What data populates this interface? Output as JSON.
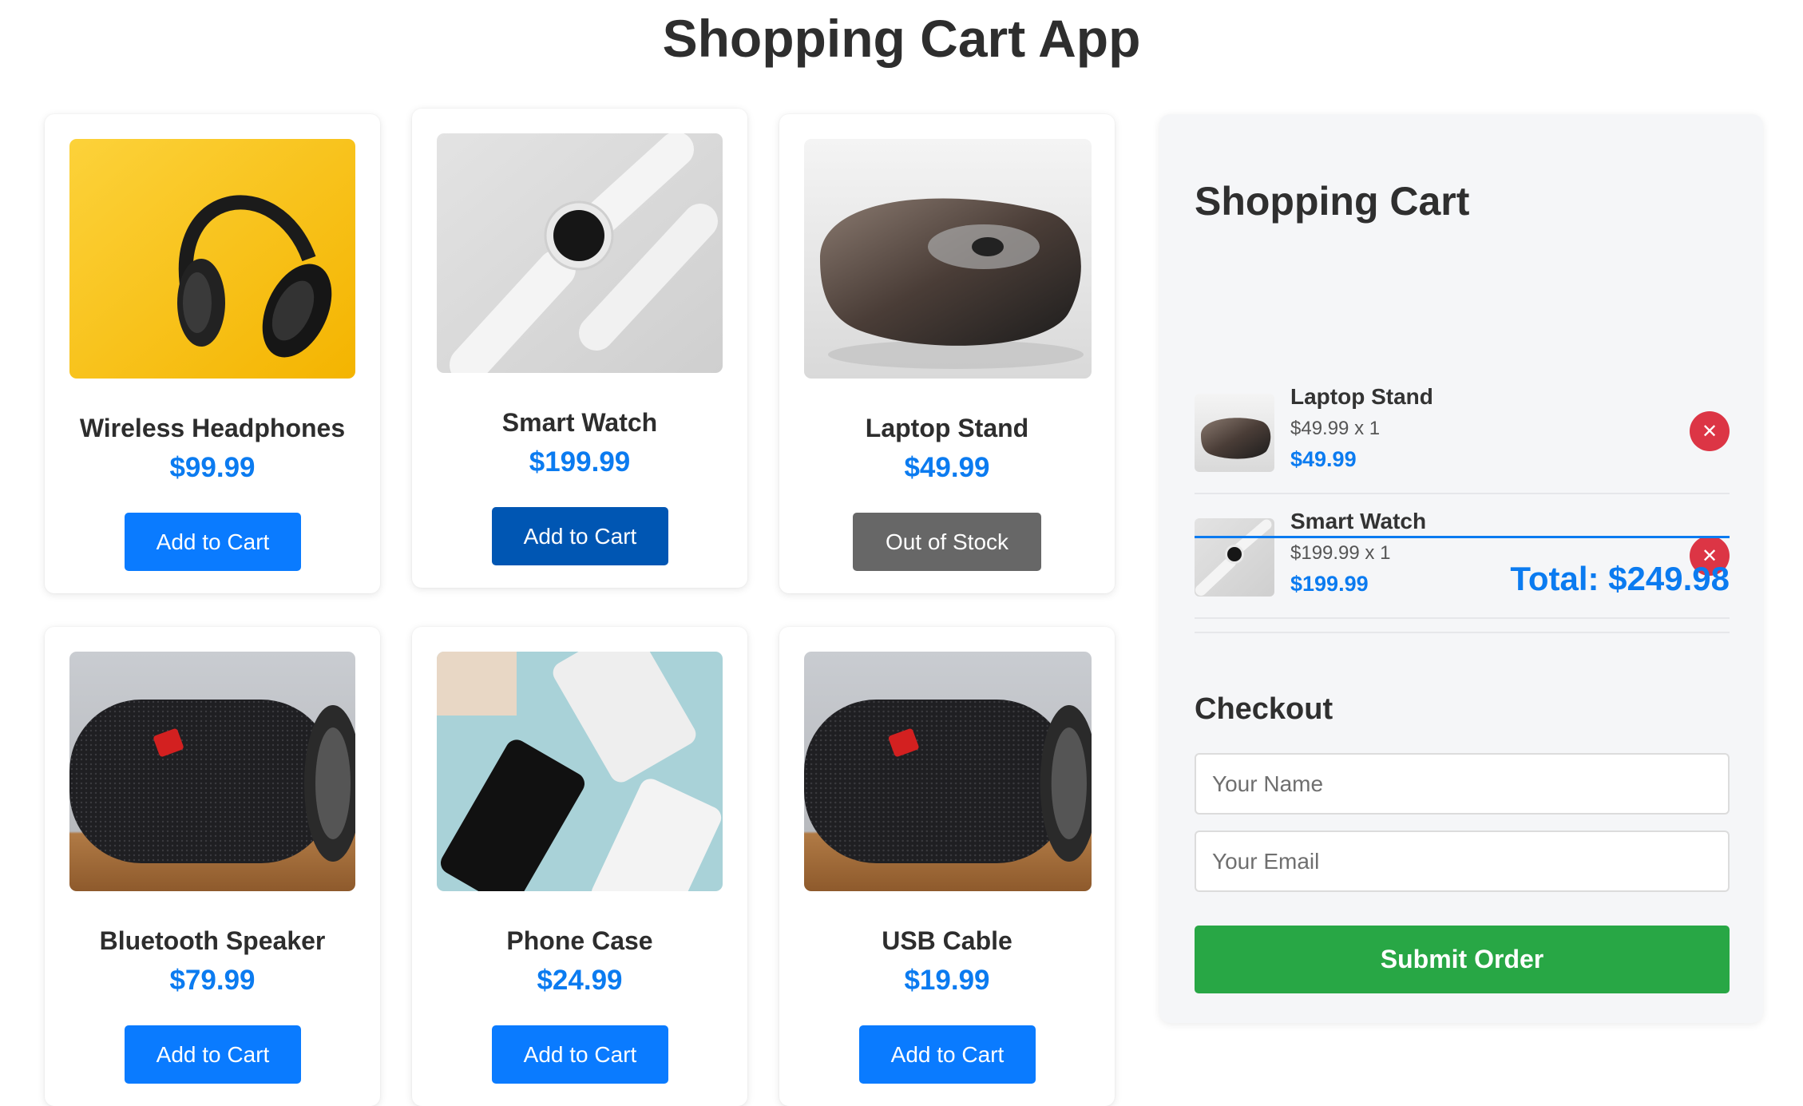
{
  "app": {
    "title": "Shopping Cart App"
  },
  "products": [
    {
      "name": "Wireless Headphones",
      "price": "$99.99",
      "button": "Add to Cart"
    },
    {
      "name": "Smart Watch",
      "price": "$199.99",
      "button": "Add to Cart"
    },
    {
      "name": "Laptop Stand",
      "price": "$49.99",
      "button": "Out of Stock"
    },
    {
      "name": "Bluetooth Speaker",
      "price": "$79.99",
      "button": "Add to Cart"
    },
    {
      "name": "Phone Case",
      "price": "$24.99",
      "button": "Add to Cart"
    },
    {
      "name": "USB Cable",
      "price": "$19.99",
      "button": "Add to Cart"
    }
  ],
  "cart": {
    "title": "Shopping Cart",
    "items": [
      {
        "name": "Laptop Stand",
        "qty_line": "$49.99 x 1",
        "subtotal": "$49.99",
        "remove": "✕"
      },
      {
        "name": "Smart Watch",
        "qty_line": "$199.99 x 1",
        "subtotal": "$199.99",
        "remove": "✕"
      }
    ],
    "total": "Total: $249.98"
  },
  "checkout": {
    "title": "Checkout",
    "name_placeholder": "Your Name",
    "email_placeholder": "Your Email",
    "submit_label": "Submit Order"
  },
  "colors": {
    "accent": "#0a7bff",
    "accent_dark": "#0056b3",
    "disabled": "#676767",
    "danger": "#dc3545",
    "success": "#28a745"
  }
}
